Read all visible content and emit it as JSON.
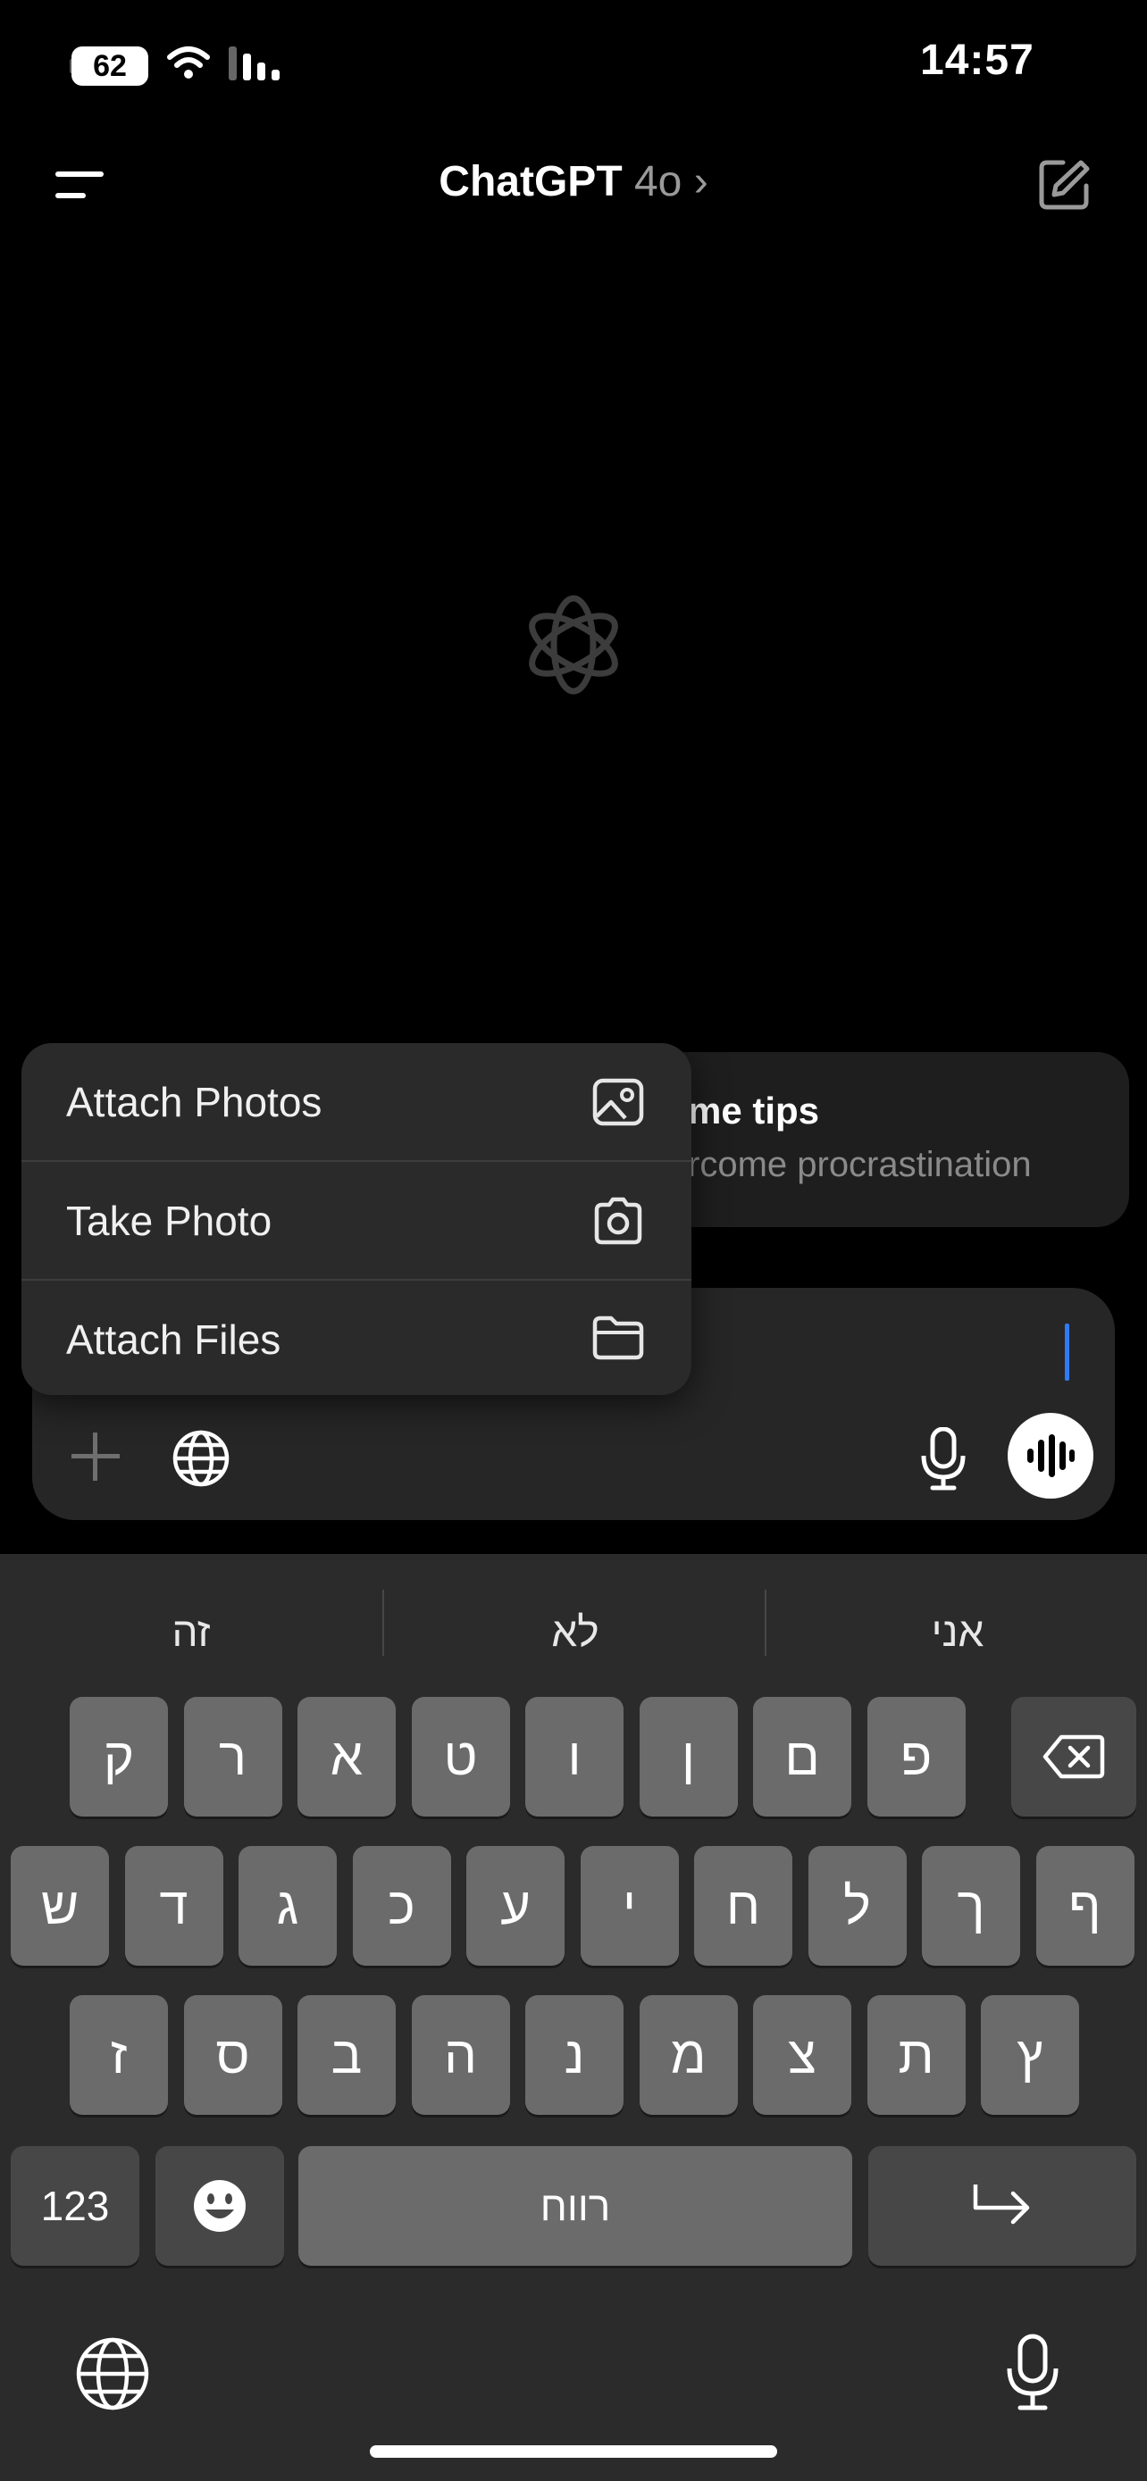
{
  "status_bar": {
    "battery": "62",
    "time": "14:57"
  },
  "header": {
    "title": "ChatGPT",
    "model": "4o",
    "chevron": "›"
  },
  "suggestion": {
    "title": "me tips",
    "subtitle": "rcome procrastination"
  },
  "attach_menu": {
    "items": [
      {
        "label": "Attach Photos",
        "icon": "photo-icon"
      },
      {
        "label": "Take Photo",
        "icon": "camera-icon"
      },
      {
        "label": "Attach Files",
        "icon": "folder-icon"
      }
    ]
  },
  "keyboard": {
    "predictions": [
      "זה",
      "לא",
      "אני"
    ],
    "row1": [
      "ק",
      "ר",
      "א",
      "ט",
      "ו",
      "ן",
      "ם",
      "פ"
    ],
    "row2": [
      "ש",
      "ד",
      "ג",
      "כ",
      "ע",
      "י",
      "ח",
      "ל",
      "ך",
      "ף"
    ],
    "row3": [
      "ז",
      "ס",
      "ב",
      "ה",
      "נ",
      "מ",
      "צ",
      "ת",
      "ץ"
    ],
    "numbers_label": "123",
    "space_label": "רווח"
  },
  "colors": {
    "background": "#000000",
    "accent_caret": "#2f7bf6",
    "keyboard_bg": "#2b2b2b",
    "key": "#6b6b6b"
  }
}
